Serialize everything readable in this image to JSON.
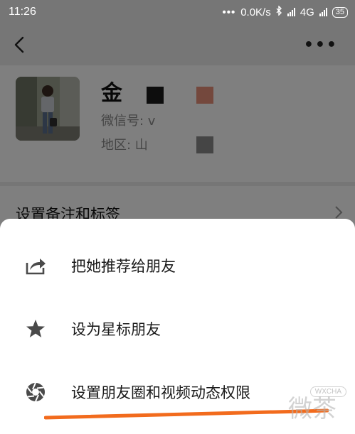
{
  "status_bar": {
    "time": "11:26",
    "dots": "•••",
    "speed": "0.0K/s",
    "network": "4G",
    "battery": "35"
  },
  "profile": {
    "name": "金",
    "wechat_id_label": "微信号: v",
    "region_label": "地区: 山",
    "censor_colors": [
      "#1a1a1a",
      "#e8907a",
      "#8a8a8a"
    ]
  },
  "remark_row": {
    "label": "设置备注和标签"
  },
  "sheet": {
    "items": [
      {
        "label": "把她推荐给朋友",
        "icon": "share-icon"
      },
      {
        "label": "设为星标朋友",
        "icon": "star-icon"
      },
      {
        "label": "设置朋友圈和视频动态权限",
        "icon": "moments-aperture-icon"
      }
    ],
    "underline_color": "#f26b1d"
  },
  "watermark": {
    "text": "微茶",
    "tag": "WXCHA"
  }
}
